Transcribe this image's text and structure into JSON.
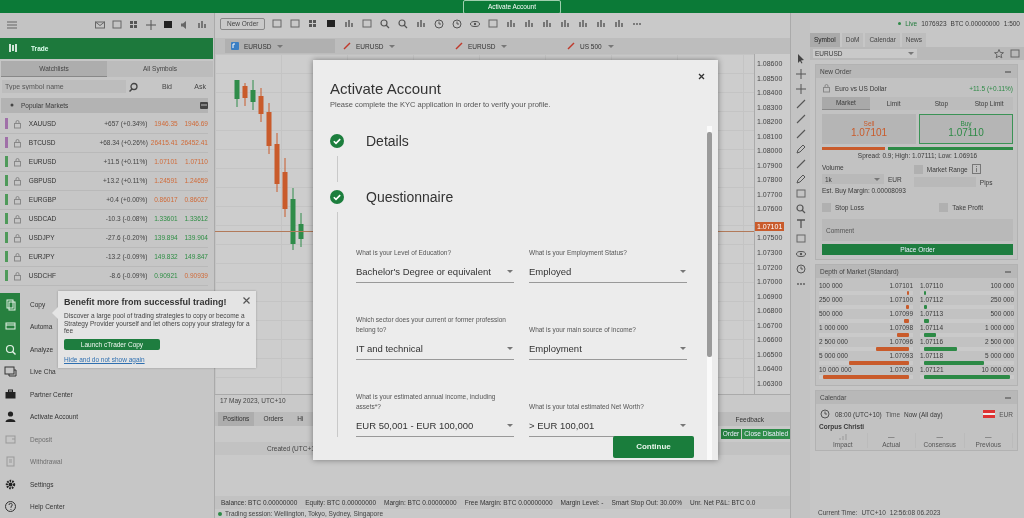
{
  "top_bar": {
    "button": "Activate Account"
  },
  "trade_header": {
    "title": "Trade"
  },
  "watchlist_tabs": [
    {
      "label": "Watchlists",
      "selected": true
    },
    {
      "label": "All Symbols",
      "selected": false
    }
  ],
  "symbol_search": {
    "placeholder": "Type symbol name"
  },
  "watchlist_columns": [
    "Bid",
    "Ask"
  ],
  "watchlist_group": {
    "title": "Popular Markets",
    "expanded": true
  },
  "symbols": [
    {
      "name": "XAUUSD",
      "change": "+657 (+0.34%)",
      "bid": "1946.35",
      "ask": "1946.69",
      "color": "#a070a8",
      "bid_up": false,
      "ask_up": false
    },
    {
      "name": "BTCUSD",
      "change": "+68.34 (+0.26%)",
      "bid": "26415.41",
      "ask": "26452.41",
      "color": "#a070a8",
      "bid_up": false,
      "ask_up": false
    },
    {
      "name": "EURUSD",
      "change": "+11.5 (+0.11%)",
      "bid": "1.07101",
      "ask": "1.07110",
      "color": "#4f9a5a",
      "bid_up": false,
      "ask_up": false
    },
    {
      "name": "GBPUSD",
      "change": "+13.2 (+0.11%)",
      "bid": "1.24591",
      "ask": "1.24659",
      "color": "#4f9a5a",
      "bid_up": false,
      "ask_up": false
    },
    {
      "name": "EURGBP",
      "change": "+0.4 (+0.00%)",
      "bid": "0.86017",
      "ask": "0.86027",
      "color": "#4f9a5a",
      "bid_up": false,
      "ask_up": false
    },
    {
      "name": "USDCAD",
      "change": "-10.3 (-0.08%)",
      "bid": "1.33601",
      "ask": "1.33612",
      "color": "#4f9a5a",
      "bid_up": true,
      "ask_up": true
    },
    {
      "name": "USDJPY",
      "change": "-27.6 (-0.20%)",
      "bid": "139.894",
      "ask": "139.904",
      "color": "#4f9a5a",
      "bid_up": true,
      "ask_up": true
    },
    {
      "name": "EURJPY",
      "change": "-13.2 (-0.09%)",
      "bid": "149.832",
      "ask": "149.847",
      "color": "#4f9a5a",
      "bid_up": true,
      "ask_up": true
    },
    {
      "name": "USDCHF",
      "change": "-8.6 (-0.09%)",
      "bid": "0.90921",
      "ask": "0.90939",
      "color": "#4f9a5a",
      "bid_up": true,
      "ask_up": false
    }
  ],
  "nav": [
    {
      "label": "Copy",
      "highlighted": true,
      "disabled": false,
      "kind": "copy"
    },
    {
      "label": "Automa",
      "highlighted": true,
      "disabled": false,
      "kind": "automate"
    },
    {
      "label": "Analyze",
      "highlighted": true,
      "disabled": false,
      "kind": "analyze"
    },
    {
      "label": "Live Cha",
      "highlighted": false,
      "disabled": false,
      "kind": "chat"
    },
    {
      "label": "Partner Center",
      "highlighted": false,
      "disabled": false,
      "kind": "partner"
    },
    {
      "label": "Activate Account",
      "highlighted": false,
      "disabled": false,
      "kind": "account"
    },
    {
      "label": "Deposit",
      "highlighted": false,
      "disabled": true,
      "kind": "deposit"
    },
    {
      "label": "Withdrawal",
      "highlighted": false,
      "disabled": true,
      "kind": "withdraw"
    },
    {
      "label": "Settings",
      "highlighted": false,
      "disabled": false,
      "kind": "settings"
    },
    {
      "label": "Help Center",
      "highlighted": false,
      "disabled": false,
      "kind": "help"
    }
  ],
  "copy_popup": {
    "title": "Benefit more from successful trading!",
    "text": "Discover a large pool of trading strategies to copy or become a Strategy Provider yourself and let others copy your strategy for a fee",
    "button": "Launch cTrader Copy",
    "link": "Hide and do not show again"
  },
  "chart_toolbar": {
    "button": "New Order"
  },
  "chart_tabs": [
    {
      "symbol": "EURUSD",
      "selected": true
    },
    {
      "symbol": "EURUSD",
      "selected": false
    },
    {
      "symbol": "EURUSD",
      "selected": false
    },
    {
      "symbol": "US 500",
      "selected": false
    }
  ],
  "price_axis": [
    "1.08600",
    "1.08500",
    "1.08400",
    "1.08300",
    "1.08200",
    "1.08100",
    "1.08000",
    "1.07900",
    "1.07800",
    "1.07700",
    "1.07600",
    "1.07500",
    "1.07300",
    "1.07200",
    "1.07000",
    "1.06900",
    "1.06800",
    "1.06700",
    "1.06600",
    "1.06500",
    "1.06400",
    "1.06300"
  ],
  "current_price": "1.07101",
  "date_axis": "17 May 2023, UTC+10",
  "bottom_tabs": [
    {
      "label": "Positions",
      "selected": true
    },
    {
      "label": "Orders",
      "selected": false
    },
    {
      "label": "Hi",
      "selected": false
    }
  ],
  "feedback": "Feedback",
  "order_buttons": [
    "Order",
    "Close Disabled"
  ],
  "positions_header": "Created (UTC+1",
  "account_bar": [
    "Balance:  BTC 0.00000000",
    "Equity:  BTC 0.00000000",
    "Margin:  BTC 0.00000000",
    "Free Margin:  BTC 0.00000000",
    "Margin Level:  -",
    "Smart Stop Out:  30.00%",
    "Unr. Net P&L:  BTC 0.0"
  ],
  "status_bar": {
    "session": "Trading session: Wellington, Tokyo, Sydney, Singapore",
    "time_label": "Current Time:",
    "timezone": "UTC+10",
    "time": "12:56:08 06.2023"
  },
  "account_info": {
    "status": "Live",
    "number": "1076923",
    "balance": "BTC 0.00000000",
    "leverage": "1:500"
  },
  "right_tabs": [
    {
      "label": "Symbol",
      "selected": true
    },
    {
      "label": "DoM",
      "selected": false
    },
    {
      "label": "Calendar",
      "selected": false
    },
    {
      "label": "News",
      "selected": false
    }
  ],
  "symbol_select": "EURUSD",
  "new_order": {
    "title": "New Order",
    "symbol_name": "Euro vs US Dollar",
    "change": "+11.5 (+0.11%)",
    "order_types": [
      {
        "label": "Market",
        "selected": true
      },
      {
        "label": "Limit",
        "selected": false
      },
      {
        "label": "Stop",
        "selected": false
      },
      {
        "label": "Stop Limit",
        "selected": false
      }
    ],
    "sell_label": "Sell",
    "sell_price": "1.07101",
    "buy_label": "Buy",
    "buy_price": "1.07110",
    "buy_selected": true,
    "spread": "Spread: 0.9; High: 1.07111; Low: 1.06916",
    "volume_label": "Volume",
    "volume": "1k",
    "currency": "EUR",
    "market_range": {
      "label": "Market Range",
      "checked": false
    },
    "pips": "Pips",
    "margin": "Est. Buy Margin: 0.00008093",
    "stop_loss": {
      "label": "Stop Loss",
      "checked": false
    },
    "take_profit": {
      "label": "Take Profit",
      "checked": false
    },
    "comment_placeholder": "Comment",
    "button": "Place Order"
  },
  "depth_of_market": {
    "title": "Depth of Market (Standard)",
    "sell": [
      {
        "volume": "100 000",
        "price": "1.07101",
        "level": 0.02
      },
      {
        "volume": "250 000",
        "price": "1.07100",
        "level": 0.03
      },
      {
        "volume": "500 000",
        "price": "1.07099",
        "level": 0.06
      },
      {
        "volume": "1 000 000",
        "price": "1.07098",
        "level": 0.14
      },
      {
        "volume": "2 500 000",
        "price": "1.07096",
        "level": 0.38
      },
      {
        "volume": "5 000 000",
        "price": "1.07093",
        "level": 0.7
      },
      {
        "volume": "10 000 000",
        "price": "1.07090",
        "level": 1.0
      }
    ],
    "buy": [
      {
        "volume": "100 000",
        "price": "1.07110",
        "level": 0.02
      },
      {
        "volume": "250 000",
        "price": "1.07112",
        "level": 0.03
      },
      {
        "volume": "500 000",
        "price": "1.07113",
        "level": 0.06
      },
      {
        "volume": "1 000 000",
        "price": "1.07114",
        "level": 0.14
      },
      {
        "volume": "2 500 000",
        "price": "1.07116",
        "level": 0.38
      },
      {
        "volume": "5 000 000",
        "price": "1.07118",
        "level": 0.7
      },
      {
        "volume": "10 000 000",
        "price": "1.07121",
        "level": 1.0
      }
    ]
  },
  "calendar": {
    "title": "Calendar",
    "time": "08:00 (UTC+10)",
    "time_label": "Time",
    "when": "Now (All day)",
    "currency": "EUR",
    "event": "Corpus Christi",
    "columns": [
      {
        "label": "Impact"
      },
      {
        "label": "Actual",
        "value": "—"
      },
      {
        "label": "Consensus",
        "value": "—"
      },
      {
        "label": "Previous",
        "value": "—"
      }
    ]
  },
  "modal": {
    "title": "Activate Account",
    "subtitle": "Please complete the KYC application in order to verify your profile.",
    "steps": [
      {
        "label": "Details",
        "done": true
      },
      {
        "label": "Questionnaire",
        "done": true
      }
    ],
    "questions": [
      {
        "label": "What is your Level of Education?",
        "value": "Bachelor's Degree or equivalent"
      },
      {
        "label": "What is your Employment Status?",
        "value": "Employed"
      },
      {
        "label": "Which sector does your current or former profession belong to?",
        "value": "IT and technical"
      },
      {
        "label": "What is your main source of income?",
        "value": "Employment"
      },
      {
        "label": "What is your estimated annual income, including assets*?",
        "value": "EUR 50,001 - EUR 100,000"
      },
      {
        "label": "What is your total estimated Net Worth?",
        "value": "> EUR 100,001"
      }
    ],
    "button": "Continue"
  }
}
